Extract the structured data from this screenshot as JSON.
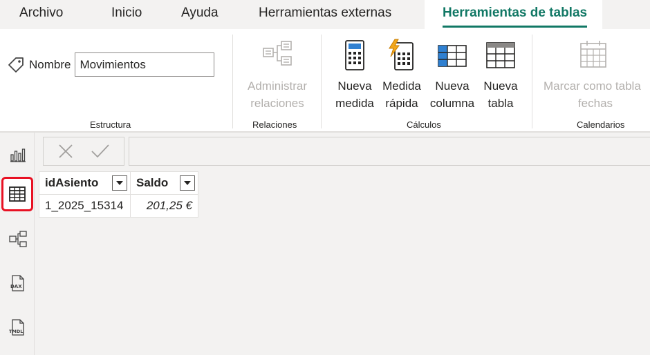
{
  "menu": {
    "tabs": [
      "Archivo",
      "Inicio",
      "Ayuda",
      "Herramientas externas",
      "Herramientas de tablas"
    ],
    "active": "Herramientas de tablas"
  },
  "ribbon": {
    "estructura": {
      "label": "Estructura",
      "name_label": "Nombre",
      "name_value": "Movimientos"
    },
    "relaciones": {
      "label": "Relaciones",
      "manage_line1": "Administrar",
      "manage_line2": "relaciones"
    },
    "calculos": {
      "label": "Cálculos",
      "new_measure": [
        "Nueva",
        "medida"
      ],
      "quick_measure": [
        "Medida",
        "rápida"
      ],
      "new_column": [
        "Nueva",
        "columna"
      ],
      "new_table": [
        "Nueva",
        "tabla"
      ]
    },
    "calendarios": {
      "label": "Calendarios",
      "mark_line1": "Marcar como tabla",
      "mark_line2": "fechas"
    }
  },
  "table": {
    "columns": [
      "idAsiento",
      "Saldo"
    ],
    "rows": [
      [
        "1_2025_15314",
        "201,25 €"
      ]
    ]
  },
  "colors": {
    "accent": "#117865",
    "highlight": "#e81123"
  },
  "rail_icons": [
    "report-view-icon",
    "table-view-icon",
    "model-view-icon",
    "dax-query-icon",
    "tmdl-view-icon"
  ]
}
